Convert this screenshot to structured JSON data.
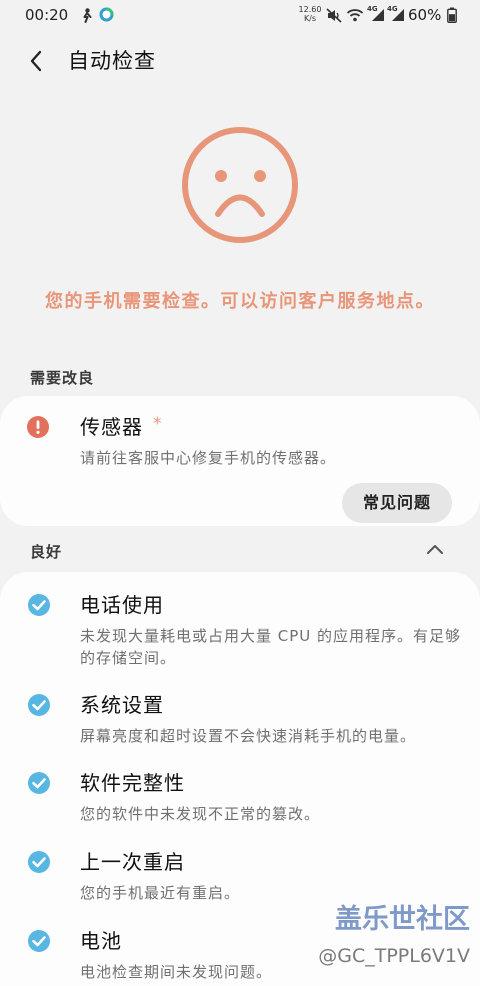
{
  "status_bar": {
    "time": "00:20",
    "net_speed_value": "12.60",
    "net_speed_unit": "K/s",
    "signal_1_label": "4G",
    "signal_2_label": "4G",
    "battery_text": "60%",
    "icons": [
      "person-icon",
      "circle-app-icon",
      "mute-icon",
      "wifi-icon",
      "signal-icon",
      "signal-icon",
      "battery-icon"
    ]
  },
  "header": {
    "back_icon": "back-arrow-icon",
    "title": "自动检查"
  },
  "hero": {
    "icon": "sad-face-icon",
    "message": "您的手机需要检查。可以访问客户服务地点。"
  },
  "needs_improvement": {
    "heading": "需要改良",
    "items": [
      {
        "icon": "warning-icon",
        "title": "传感器",
        "marker": "*",
        "description": "请前往客服中心修复手机的传感器。",
        "button_label": "常见问题"
      }
    ]
  },
  "good": {
    "heading": "良好",
    "toggle_icon": "chevron-up-icon",
    "items": [
      {
        "icon": "check-icon",
        "title": "电话使用",
        "description": "未发现大量耗电或占用大量 CPU 的应用程序。有足够的存储空间。"
      },
      {
        "icon": "check-icon",
        "title": "系统设置",
        "description": "屏幕亮度和超时设置不会快速消耗手机的电量。"
      },
      {
        "icon": "check-icon",
        "title": "软件完整性",
        "description": "您的软件中未发现不正常的篡改。"
      },
      {
        "icon": "check-icon",
        "title": "上一次重启",
        "description": "您的手机最近有重启。"
      },
      {
        "icon": "check-icon",
        "title": "电池",
        "description": "电池检查期间未发现问题。"
      }
    ]
  },
  "watermark": {
    "logo_text": "盖乐世社区",
    "handle": "@GC_TPPL6V1V"
  },
  "colors": {
    "background": "#F2F2F2",
    "card": "#FDFDFD",
    "alert_orange": "#E8967A",
    "warning_red": "#E3705D",
    "check_blue": "#58B6E2",
    "button_bg": "#E6E6E6"
  }
}
